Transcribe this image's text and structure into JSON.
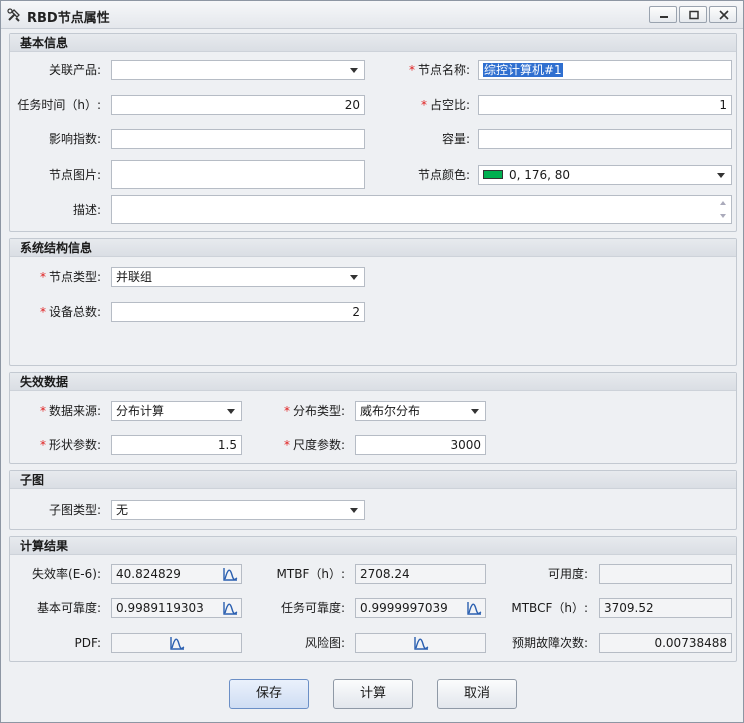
{
  "window": {
    "title": "RBD节点属性"
  },
  "basic": {
    "heading": "基本信息",
    "product_label": "关联产品:",
    "product_value": "",
    "name_label": "节点名称:",
    "name_value": "综控计算机#1",
    "task_time_label": "任务时间（h）:",
    "task_time_value": "20",
    "duty_label": "占空比:",
    "duty_value": "1",
    "impact_label": "影响指数:",
    "impact_value": "",
    "capacity_label": "容量:",
    "capacity_value": "",
    "image_label": "节点图片:",
    "color_label": "节点颜色:",
    "color_value": "0, 176, 80",
    "color_hex": "#00b050",
    "desc_label": "描述:",
    "desc_value": ""
  },
  "structure": {
    "heading": "系统结构信息",
    "type_label": "节点类型:",
    "type_value": "并联组",
    "count_label": "设备总数:",
    "count_value": "2"
  },
  "failure": {
    "heading": "失效数据",
    "source_label": "数据来源:",
    "source_value": "分布计算",
    "dist_label": "分布类型:",
    "dist_value": "威布尔分布",
    "shape_label": "形状参数:",
    "shape_value": "1.5",
    "scale_label": "尺度参数:",
    "scale_value": "3000"
  },
  "subgraph": {
    "heading": "子图",
    "type_label": "子图类型:",
    "type_value": "无"
  },
  "results": {
    "heading": "计算结果",
    "failure_rate_label": "失效率(E-6):",
    "failure_rate_value": "40.824829",
    "mtbf_label": "MTBF（h）:",
    "mtbf_value": "2708.24",
    "availability_label": "可用度:",
    "availability_value": "",
    "basic_rel_label": "基本可靠度:",
    "basic_rel_value": "0.9989119303",
    "task_rel_label": "任务可靠度:",
    "task_rel_value": "0.9999997039",
    "mtbcf_label": "MTBCF（h）:",
    "mtbcf_value": "3709.52",
    "pdf_label": "PDF:",
    "risk_label": "风险图:",
    "expected_label": "预期故障次数:",
    "expected_value": "0.00738488"
  },
  "buttons": {
    "save": "保存",
    "calc": "计算",
    "cancel": "取消"
  },
  "icons": {
    "app": "tools-icon",
    "chart": "curve-chart-icon"
  },
  "colors": {
    "required": "#e02020",
    "selection": "#2f6fd0",
    "node_color": "#00b050"
  }
}
